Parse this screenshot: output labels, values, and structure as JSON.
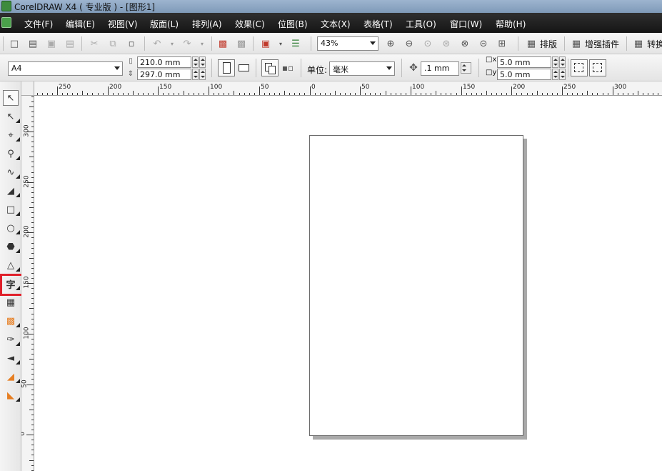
{
  "title_bar": {
    "title": "CorelDRAW X4 ( 专业版 ) - [图形1]"
  },
  "menu": {
    "items": [
      "文件(F)",
      "编辑(E)",
      "视图(V)",
      "版面(L)",
      "排列(A)",
      "效果(C)",
      "位图(B)",
      "文本(X)",
      "表格(T)",
      "工具(O)",
      "窗口(W)",
      "帮助(H)"
    ]
  },
  "toolbar": {
    "zoom_level": "43%",
    "buttons": [
      "排版",
      "增强插件",
      "转换"
    ]
  },
  "property_bar": {
    "page_size": "A4",
    "width": "210.0 mm",
    "height": "297.0 mm",
    "units_label": "单位:",
    "units_value": "毫米",
    "nudge": ".1 mm",
    "dup_x": "5.0 mm",
    "dup_y": "5.0 mm"
  },
  "rulers": {
    "horizontal_labels": [
      "250",
      "200",
      "150",
      "100",
      "50",
      "0",
      "50",
      "100",
      "150",
      "200",
      "250",
      "300"
    ],
    "vertical_labels": [
      "300",
      "250",
      "200",
      "150",
      "100",
      "50",
      "0"
    ]
  },
  "toolbox": {
    "tools": [
      "pick-tool",
      "shape-tool",
      "crop-tool",
      "zoom-tool",
      "freehand-tool",
      "smart-fill-tool",
      "rectangle-tool",
      "ellipse-tool",
      "polygon-tool",
      "basic-shapes-tool",
      "text-tool",
      "table-tool",
      "interactive-blend-tool",
      "eyedropper-tool",
      "outline-tool",
      "fill-tool",
      "interactive-fill-tool"
    ],
    "text_tool_glyph": "字",
    "highlight_color": "#e0202a"
  }
}
